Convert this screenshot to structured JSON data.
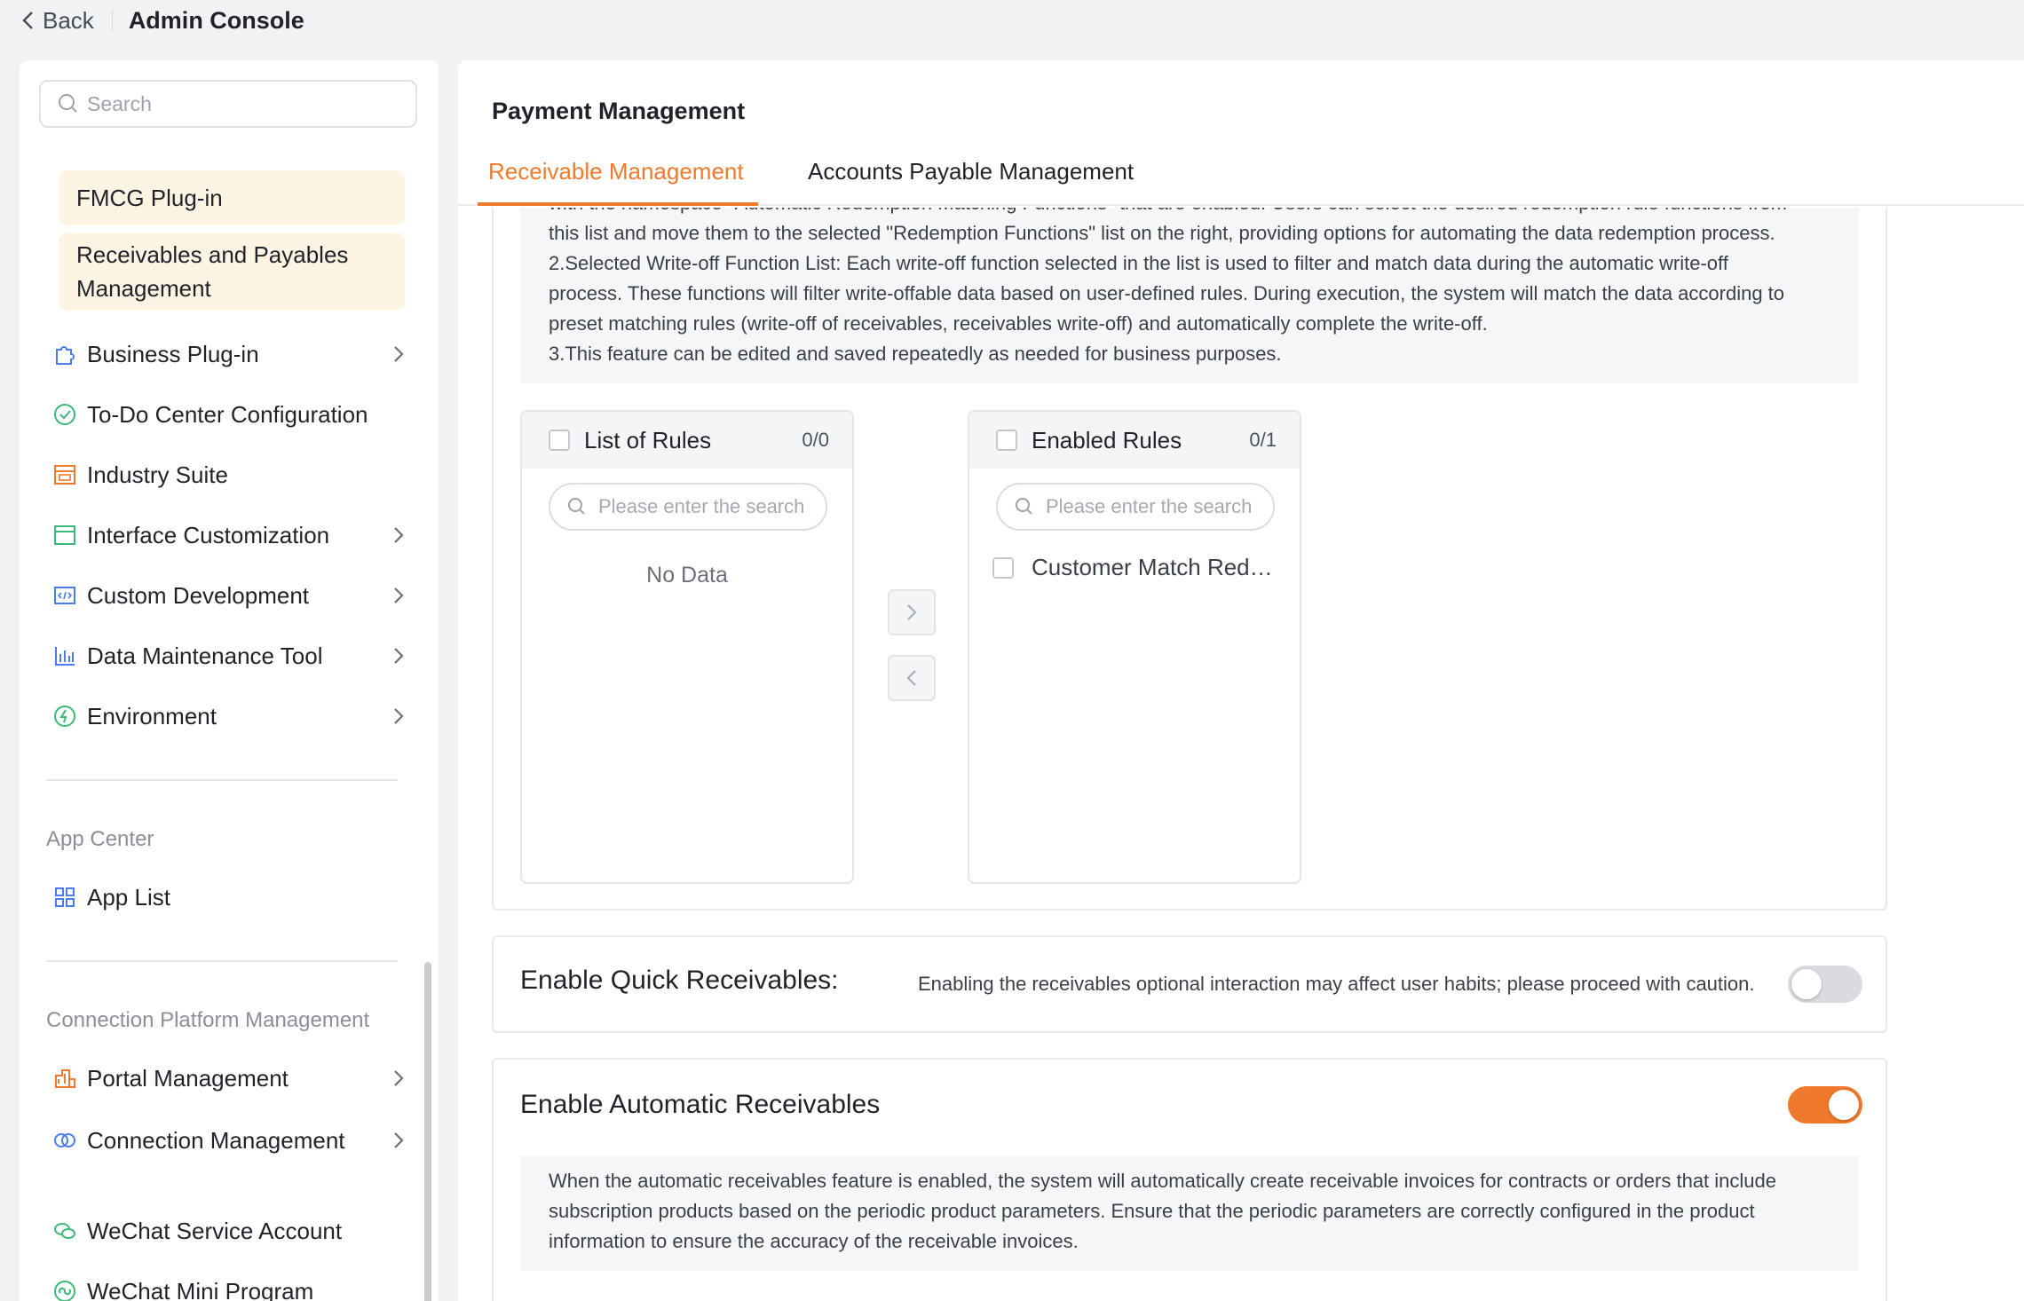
{
  "topbar": {
    "back_label": "Back",
    "title": "Admin Console"
  },
  "sidebar": {
    "search_placeholder": "Search",
    "sub_items": [
      "FMCG Plug-in",
      "Receivables and Payables Management"
    ],
    "items": [
      {
        "label": "Business Plug-in",
        "icon": "puzzle-icon",
        "expandable": true
      },
      {
        "label": "To-Do Center Configuration",
        "icon": "check-circle-icon",
        "expandable": false
      },
      {
        "label": "Industry Suite",
        "icon": "suite-icon",
        "expandable": false
      },
      {
        "label": "Interface Customization",
        "icon": "window-icon",
        "expandable": true
      },
      {
        "label": "Custom Development",
        "icon": "code-icon",
        "expandable": true
      },
      {
        "label": "Data Maintenance Tool",
        "icon": "bar-chart-icon",
        "expandable": true
      },
      {
        "label": "Environment",
        "icon": "environment-icon",
        "expandable": true
      }
    ],
    "app_center": {
      "title": "App Center",
      "items": [
        {
          "label": "App List",
          "icon": "grid-icon"
        }
      ]
    },
    "connection": {
      "title": "Connection Platform Management",
      "items": [
        {
          "label": "Portal Management",
          "icon": "building-icon",
          "expandable": true
        },
        {
          "label": "Connection Management",
          "icon": "link-rings-icon",
          "expandable": true
        },
        {
          "label": "WeChat Service Account",
          "icon": "wechat-icon",
          "expandable": false
        },
        {
          "label": "WeChat Mini Program",
          "icon": "mini-program-icon",
          "expandable": false
        }
      ]
    }
  },
  "main": {
    "title": "Payment Management",
    "tabs": [
      {
        "label": "Receivable Management",
        "active": true
      },
      {
        "label": "Accounts Payable Management",
        "active": false
      }
    ],
    "description_lines": [
      "with the namespace \"Automatic Redemption Matching Functions\" that are enabled. Users can select the desired redemption rule functions from",
      "this list and move them to the selected \"Redemption Functions\" list on the right, providing options for automating the data redemption process.",
      "2.Selected Write-off Function List: Each write-off function selected in the list is used to filter and match data during the automatic write-off",
      "process. These functions will filter write-offable data based on user-defined rules. During execution, the system will match the data according to",
      "preset matching rules (write-off of receivables, receivables write-off) and automatically complete the write-off.",
      "3.This feature can be edited and saved repeatedly as needed for business purposes."
    ],
    "transfer": {
      "left": {
        "title": "List of Rules",
        "count": "0/0",
        "search_placeholder": "Please enter the search",
        "empty_text": "No Data"
      },
      "right": {
        "title": "Enabled Rules",
        "count": "0/1",
        "search_placeholder": "Please enter the search",
        "items": [
          "Customer Match Redemption"
        ]
      }
    },
    "quick_receivables": {
      "label": "Enable Quick Receivables:",
      "hint": "Enabling the receivables optional interaction may affect user habits; please proceed with caution.",
      "enabled": false
    },
    "auto_receivables": {
      "label": "Enable Automatic Receivables",
      "enabled": true,
      "description_lines": [
        "When the automatic receivables feature is enabled, the system will automatically create receivable invoices for contracts or orders that include",
        "subscription products based on the periodic product parameters. Ensure that the periodic parameters are correctly configured in the product",
        "information to ensure the accuracy of the receivable invoices."
      ]
    }
  },
  "colors": {
    "accent": "#f07a2c",
    "highlight_bg": "#fdf4e3",
    "page_bg": "#f1f2f4"
  }
}
